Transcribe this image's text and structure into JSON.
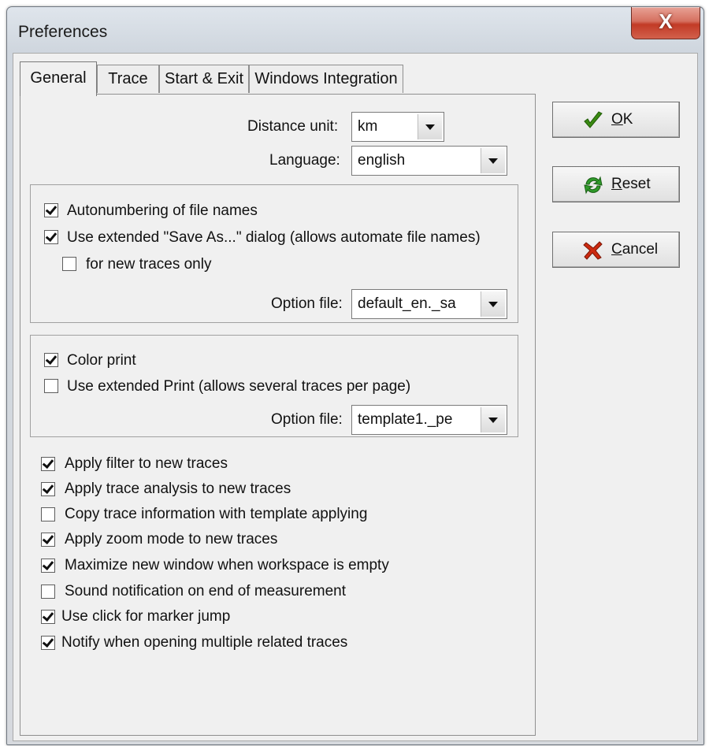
{
  "window": {
    "title": "Preferences",
    "close_glyph": "X"
  },
  "tabs": [
    {
      "label": "General",
      "active": true
    },
    {
      "label": "Trace",
      "active": false
    },
    {
      "label": "Start & Exit",
      "active": false
    },
    {
      "label": "Windows Integration",
      "active": false
    }
  ],
  "general": {
    "distance_unit": {
      "label": "Distance unit:",
      "value": "km"
    },
    "language": {
      "label": "Language:",
      "value": "english"
    },
    "save_group": {
      "autonumbering": {
        "label": "Autonumbering of file names",
        "checked": true
      },
      "extended_save": {
        "label": "Use extended \"Save As...\" dialog (allows automate file names)",
        "checked": true
      },
      "new_traces_only": {
        "label": "for new traces only",
        "checked": false
      },
      "option_file": {
        "label": "Option file:",
        "value": "default_en._sa"
      }
    },
    "print_group": {
      "color_print": {
        "label": "Color print",
        "checked": true
      },
      "extended_print": {
        "label": "Use extended Print (allows several traces per page)",
        "checked": false
      },
      "option_file": {
        "label": "Option file:",
        "value": "template1._pe"
      }
    },
    "options": [
      {
        "label": "Apply filter to new traces",
        "checked": true
      },
      {
        "label": "Apply trace analysis to new traces",
        "checked": true
      },
      {
        "label": "Copy trace information with template applying",
        "checked": false
      },
      {
        "label": "Apply zoom mode to new traces",
        "checked": true
      },
      {
        "label": "Maximize new window when workspace is empty",
        "checked": true
      },
      {
        "label": "Sound notification on end of measurement",
        "checked": false
      },
      {
        "label": "Use click for marker jump",
        "checked": true
      },
      {
        "label": "Notify when opening multiple related traces",
        "checked": true
      }
    ]
  },
  "buttons": {
    "ok": {
      "mnemonic": "O",
      "rest": "K",
      "icon": "checkmark-icon",
      "icon_color": "#3a8a12"
    },
    "reset": {
      "mnemonic": "R",
      "rest": "eset",
      "icon": "refresh-icon",
      "icon_color": "#2f9a2a"
    },
    "cancel": {
      "mnemonic": "C",
      "rest": "ancel",
      "icon": "red-x-icon",
      "icon_color": "#cc2a10"
    }
  }
}
